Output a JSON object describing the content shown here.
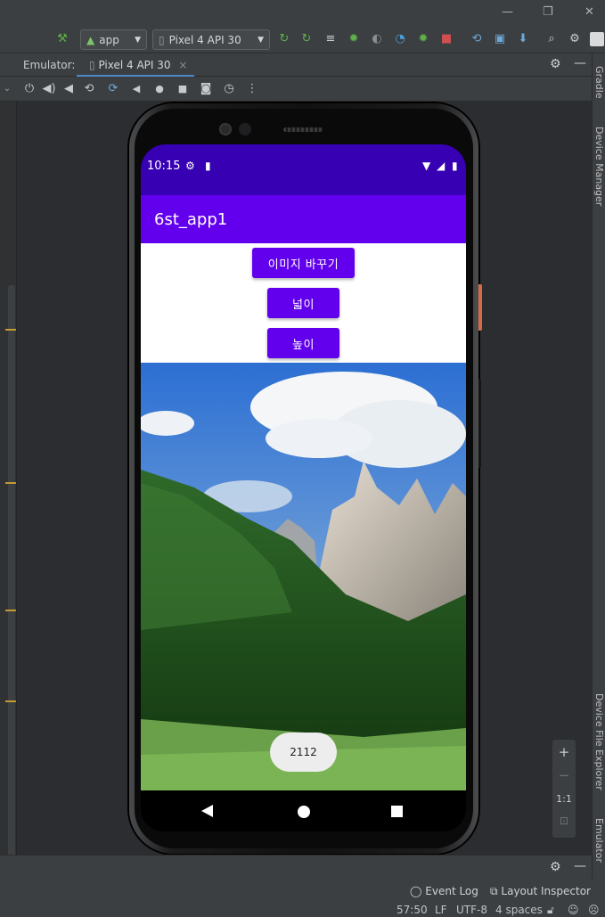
{
  "toolbar": {
    "run_config": "app",
    "device": "Pixel 4 API 30"
  },
  "emulator": {
    "label": "Emulator:",
    "tab": "Pixel 4 API 30",
    "tab_close": "×"
  },
  "right_strip": {
    "gradle": "Gradle",
    "device_manager": "Device Manager",
    "device_file_explorer": "Device File Explorer",
    "emulator": "Emulator"
  },
  "phone": {
    "status_time": "10:15",
    "app_title": "6st_app1",
    "buttons": {
      "change_image": "이미지 바꾸기",
      "width": "넓이",
      "height": "높이"
    },
    "toast": "2112"
  },
  "zoom": {
    "plus": "+",
    "minus": "−",
    "one_to_one": "1:1"
  },
  "tool_windows": {
    "event_log": "Event Log",
    "layout_inspector": "Layout Inspector"
  },
  "status_bar": {
    "position": "57:50",
    "line_sep": "LF",
    "encoding": "UTF-8",
    "indent": "4 spaces"
  },
  "colors": {
    "status_bar": "#3700b3",
    "app_bar": "#6200ee",
    "button": "#6200ee"
  }
}
